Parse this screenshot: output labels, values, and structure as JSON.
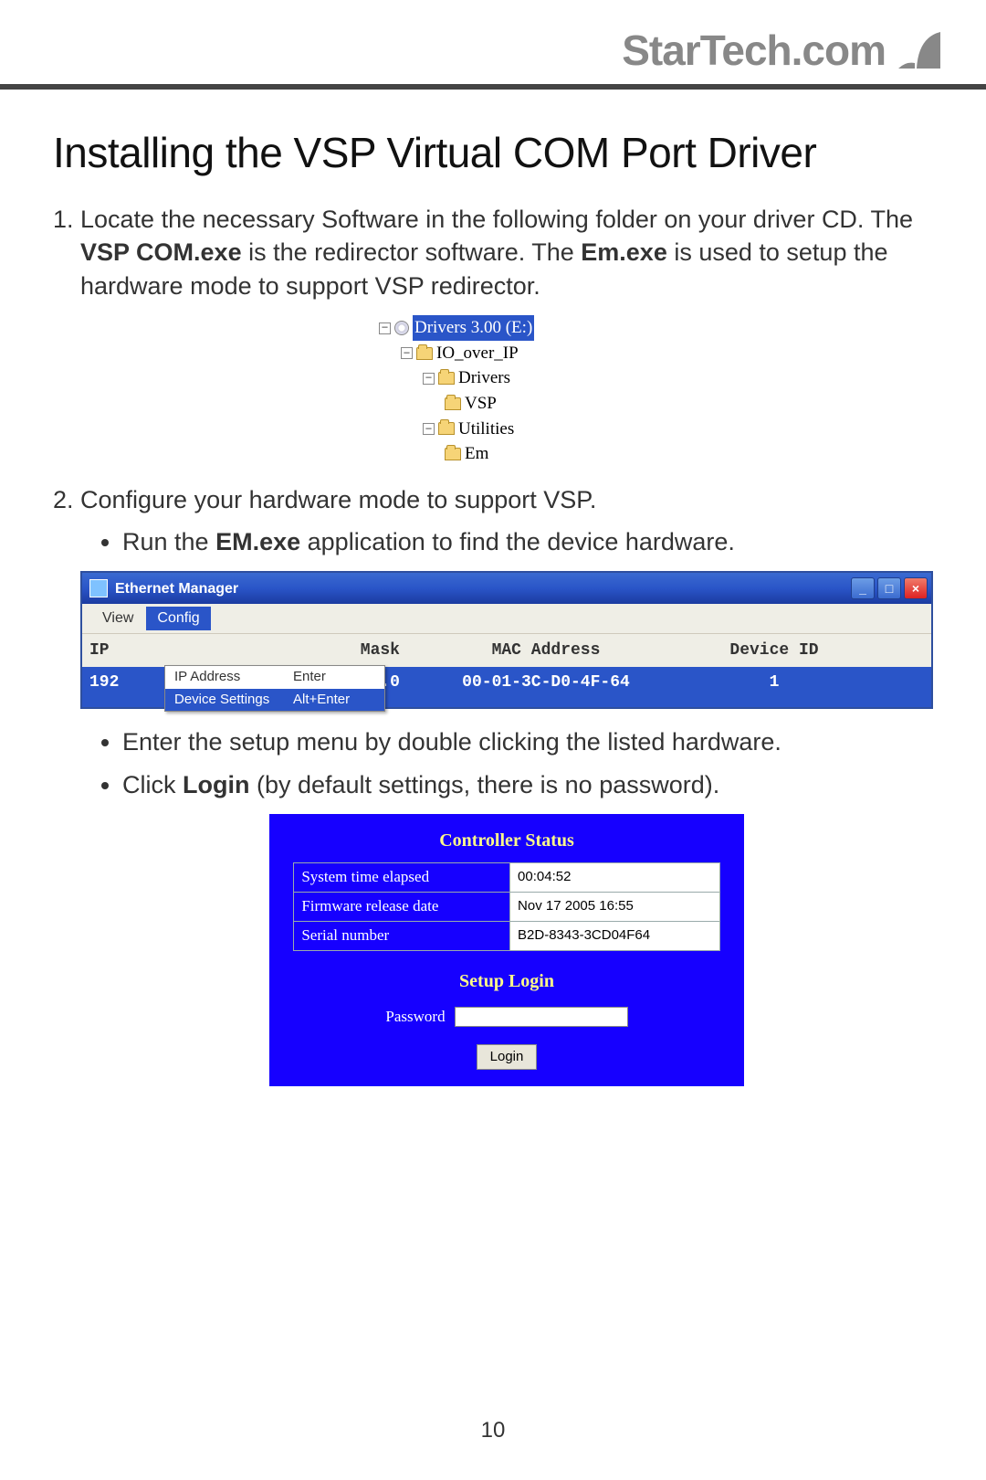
{
  "brand": "StarTech.com",
  "title": "Installing the VSP Virtual COM Port Driver",
  "step1": {
    "pre": "Locate the necessary Software in the following folder on your driver CD. The ",
    "bold1": "VSP COM.exe",
    "mid1": " is the redirector software. The ",
    "bold2": "Em.exe",
    "post": " is used to setup the hardware mode to support VSP redirector."
  },
  "tree": {
    "root": "Drivers 3.00 (E:)",
    "l1": "IO_over_IP",
    "l2a": "Drivers",
    "l3a": "VSP",
    "l2b": "Utilities",
    "l3b": "Em"
  },
  "step2": "Configure your hardware mode to support VSP.",
  "bullet2a_pre": "Run the ",
  "bullet2a_bold": "EM.exe",
  "bullet2a_post": " application to find the device hardware.",
  "bullet2b": "Enter the setup menu by double clicking the listed hardware.",
  "bullet2c_pre": "Click ",
  "bullet2c_bold": "Login",
  "bullet2c_post": " (by default settings, there is no password).",
  "em": {
    "title": "Ethernet Manager",
    "menu_view": "View",
    "menu_config": "Config",
    "popup": {
      "row1_l": "IP Address",
      "row1_r": "Enter",
      "row2_l": "Device Settings",
      "row2_r": "Alt+Enter"
    },
    "head_ip": "IP",
    "head_mask": "Mask",
    "head_mac": "MAC Address",
    "head_devid": "Device ID",
    "row_ip": "192",
    "row_mask": ".0.0",
    "row_mac": "00-01-3C-D0-4F-64",
    "row_devid": "1"
  },
  "ctrl": {
    "title": "Controller Status",
    "r1_l": "System time elapsed",
    "r1_v": "00:04:52",
    "r2_l": "Firmware release date",
    "r2_v": "Nov 17 2005 16:55",
    "r3_l": "Serial number",
    "r3_v": "B2D-8343-3CD04F64",
    "setup": "Setup Login",
    "pwd_label": "Password",
    "login": "Login"
  },
  "page": "10"
}
